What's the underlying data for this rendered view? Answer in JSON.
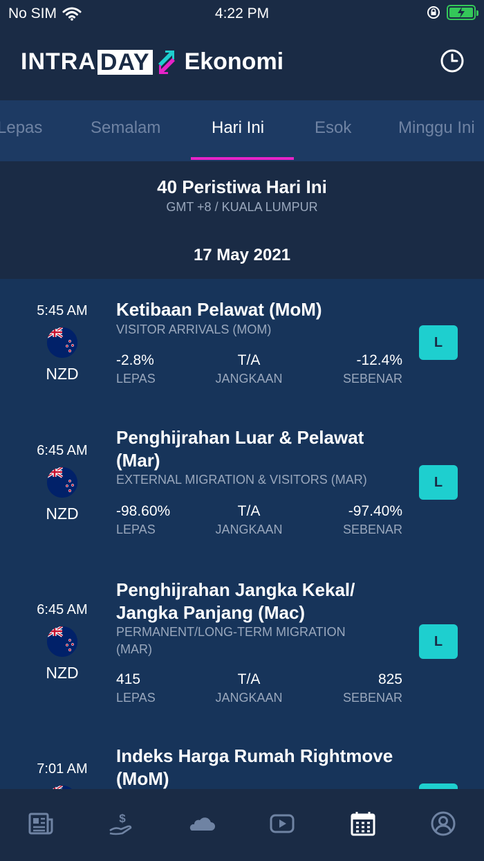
{
  "status_bar": {
    "carrier": "No SIM",
    "time": "4:22 PM"
  },
  "header": {
    "logo_intra": "INTRA",
    "logo_day": "DAY",
    "logo_econ": "Ekonomi"
  },
  "tabs": [
    {
      "label": "Lepas"
    },
    {
      "label": "Semalam"
    },
    {
      "label": "Hari Ini"
    },
    {
      "label": "Esok"
    },
    {
      "label": "Minggu Ini"
    }
  ],
  "summary": {
    "title": "40 Peristiwa Hari Ini",
    "timezone": "GMT +8 / KUALA LUMPUR",
    "date": "17 May 2021"
  },
  "labels": {
    "prev": "LEPAS",
    "forecast": "JANGKAAN",
    "actual": "SEBENAR"
  },
  "events": [
    {
      "time": "5:45 AM",
      "currency": "NZD",
      "title_lines": [
        "Ketibaan Pelawat (MoM)"
      ],
      "subtitle_lines": [
        "VISITOR ARRIVALS (MOM)"
      ],
      "previous": "-2.8%",
      "forecast": "T/A",
      "actual": "-12.4%",
      "badge": "L"
    },
    {
      "time": "6:45 AM",
      "currency": "NZD",
      "title_lines": [
        "Penghijrahan Luar & Pelawat",
        "(Mar)"
      ],
      "subtitle_lines": [
        "EXTERNAL MIGRATION & VISITORS (MAR)"
      ],
      "previous": "-98.60%",
      "forecast": "T/A",
      "actual": "-97.40%",
      "badge": "L"
    },
    {
      "time": "6:45 AM",
      "currency": "NZD",
      "title_lines": [
        "Penghijrahan Jangka Kekal/",
        "Jangka Panjang (Mac)"
      ],
      "subtitle_lines": [
        "PERMANENT/LONG-TERM MIGRATION",
        "(MAR)"
      ],
      "previous": "415",
      "forecast": "T/A",
      "actual": "825",
      "badge": "L"
    },
    {
      "time": "7:01 AM",
      "title_lines": [
        "Indeks Harga Rumah Rightmove",
        "(MoM)"
      ]
    }
  ],
  "bottom_nav": [
    {
      "icon": "newspaper-icon"
    },
    {
      "icon": "dollar-hand-icon"
    },
    {
      "icon": "cloud-icon"
    },
    {
      "icon": "play-icon"
    },
    {
      "icon": "calendar-icon"
    },
    {
      "icon": "user-icon"
    }
  ],
  "colors": {
    "accent": "#e623c8",
    "badge": "#1ecfcf",
    "background": "#17345a",
    "header": "#1a2b45"
  }
}
